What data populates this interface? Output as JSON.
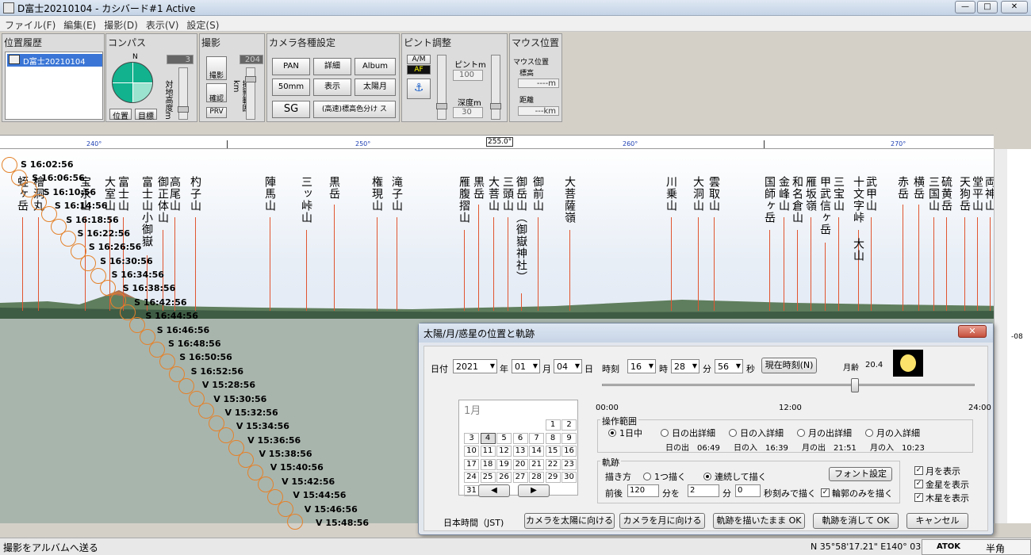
{
  "window": {
    "title": "D富士20210104 - カシバード#1 Active",
    "btn_min": "—",
    "btn_max": "□",
    "btn_close": "✕"
  },
  "menu": [
    "ファイル(F)",
    "編集(E)",
    "撮影(D)",
    "表示(V)",
    "設定(S)"
  ],
  "toolbar": {
    "history": {
      "title": "位置履歴",
      "item": "D富士20210104"
    },
    "compass": {
      "title": "コンパス",
      "north": "N",
      "value": "3",
      "vlabel": "対地高度m",
      "btn_pos": "位置",
      "btn_target": "目標"
    },
    "shoot": {
      "title": "撮影",
      "btn_shoot": "撮影",
      "btn_confirm": "確認",
      "btn_prv": "PRV",
      "value": "204",
      "vlabel": "撮影範囲km"
    },
    "camera": {
      "title": "カメラ各種設定",
      "pan": "PAN",
      "detail": "詳細",
      "album": "Album",
      "mm": "50mm",
      "display": "表示",
      "sunmoon": "太陽月",
      "sg": "SG",
      "color": "(高速)標高色分け ス"
    },
    "focus": {
      "title": "ピント調整",
      "am": "A/M",
      "af": "AF",
      "focus_label": "ピントm",
      "focus_value": "100",
      "depth_label": "深度m",
      "depth_value": "30"
    },
    "mouse": {
      "title": "マウス位置",
      "pos_label": "マウス位置",
      "alt_label": "標高",
      "alt_value": "----m",
      "dist_label": "距離",
      "dist_value": "---km"
    }
  },
  "ruler": {
    "ticks": [
      "240°",
      "250°",
      "255.0°",
      "260°",
      "270°"
    ]
  },
  "peaks": [
    "蛭ヶ岳",
    "檜洞丸",
    "宝永山",
    "大室山",
    "富士山",
    "富士山小御嶽",
    "御正体山",
    "高尾山",
    "杓子山",
    "陣馬山",
    "三ッ峠山",
    "黒岳",
    "権現山",
    "滝子山",
    "雁腹摺山",
    "黒岳",
    "大菩山",
    "三頭山",
    "御岳山（御嶽神社）",
    "御前山",
    "大菩薩嶺",
    "川乗山",
    "大洞山",
    "雲取山",
    "国師ヶ岳",
    "金峰山",
    "和名倉山",
    "雁坂嶺",
    "甲武信ヶ岳",
    "三宝山",
    "十文字峠",
    "武甲山",
    "大山",
    "赤岳",
    "横岳",
    "三国山",
    "硫黄岳",
    "天狗岳",
    "堂平山",
    "両神山"
  ],
  "sun_labels": [
    "S 16:02:56",
    "S 16:06:56",
    "S 16:10:56",
    "S 16:14:56",
    "S 16:18:56",
    "S 16:22:56",
    "S 16:26:56",
    "S 16:30:56",
    "S 16:34:56",
    "S 16:38:56",
    "S 16:42:56",
    "S 16:44:56",
    "S 16:46:56",
    "S 16:48:56",
    "S 16:50:56",
    "S 16:52:56",
    "V 15:28:56",
    "V 15:30:56",
    "V 15:32:56",
    "V 15:34:56",
    "V 15:36:56",
    "V 15:38:56",
    "V 15:40:56",
    "V 15:42:56",
    "V 15:44:56",
    "V 15:46:56",
    "V 15:48:56"
  ],
  "right_edge": {
    "text": "-08"
  },
  "dialog": {
    "title": "太陽/月/惑星の位置と軌跡",
    "close": "✕",
    "date_label": "日付",
    "year": "2021",
    "year_unit": "年",
    "month": "01",
    "month_unit": "月",
    "day": "04",
    "day_unit": "日",
    "time_label": "時刻",
    "hour": "16",
    "hour_unit": "時",
    "minute": "28",
    "minute_unit": "分",
    "second": "56",
    "second_unit": "秒",
    "now_btn": "現在時刻(N)",
    "moon_age_label": "月齢",
    "moon_age": "20.4",
    "cal_month": "1月",
    "cal_days": [
      "1",
      "2",
      "3",
      "4",
      "5",
      "6",
      "7",
      "8",
      "9",
      "10",
      "11",
      "12",
      "13",
      "14",
      "15",
      "16",
      "17",
      "18",
      "19",
      "20",
      "21",
      "22",
      "23",
      "24",
      "25",
      "26",
      "27",
      "28",
      "29",
      "30",
      "31"
    ],
    "cal_prev": "◀",
    "cal_next": "▶",
    "tz": "日本時間（JST)",
    "time_ticks": [
      "00:00",
      "12:00",
      "24:00"
    ],
    "range_title": "操作範囲",
    "range_opts": [
      "1日中",
      "日の出詳細",
      "日の入詳細",
      "月の出詳細",
      "月の入詳細"
    ],
    "sunrise": "日の出　06:49",
    "sunset": "日の入　16:39",
    "moonrise": "月の出　21:51",
    "moonset": "月の入　10:23",
    "track_title": "軌跡",
    "draw_label": "描き方",
    "draw_one": "1つ描く",
    "draw_cont": "連続して描く",
    "font_btn": "フォント設定",
    "before_after": "前後",
    "ba_value": "120",
    "min_unit_a": "分を",
    "step_min": "2",
    "min_unit_b": "分",
    "step_sec": "0",
    "sec_label": "秒刻みで描く",
    "outline_only": "輪郭のみを描く",
    "show_moon": "月を表示",
    "show_venus": "金星を表示",
    "show_jupiter": "木星を表示",
    "btn_cam_sun": "カメラを太陽に向ける",
    "btn_cam_moon": "カメラを月に向ける",
    "btn_keep_ok": "軌跡を描いたまま OK",
    "btn_clear_ok": "軌跡を消して OK",
    "btn_cancel": "キャンセル"
  },
  "status": {
    "left": "撮影をアルバムへ送る",
    "coords": "N 35°58'17.21\"  E140° 03",
    "atok": "ATOK",
    "ime": "半角"
  }
}
